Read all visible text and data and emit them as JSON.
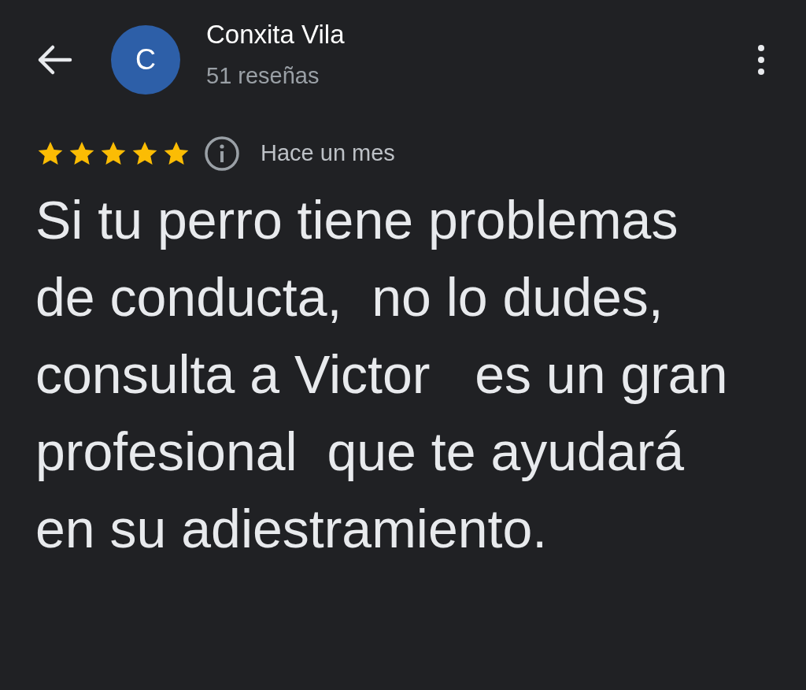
{
  "header": {
    "avatar_initial": "C",
    "name": "Conxita Vila",
    "review_count": "51 reseñas"
  },
  "review": {
    "stars": 5,
    "time": "Hace un mes",
    "text": "Si tu perro tiene problemas de conducta,  no lo dudes, consulta a Victor   es un gran profesional  que te ayudará en su adiestramiento."
  }
}
